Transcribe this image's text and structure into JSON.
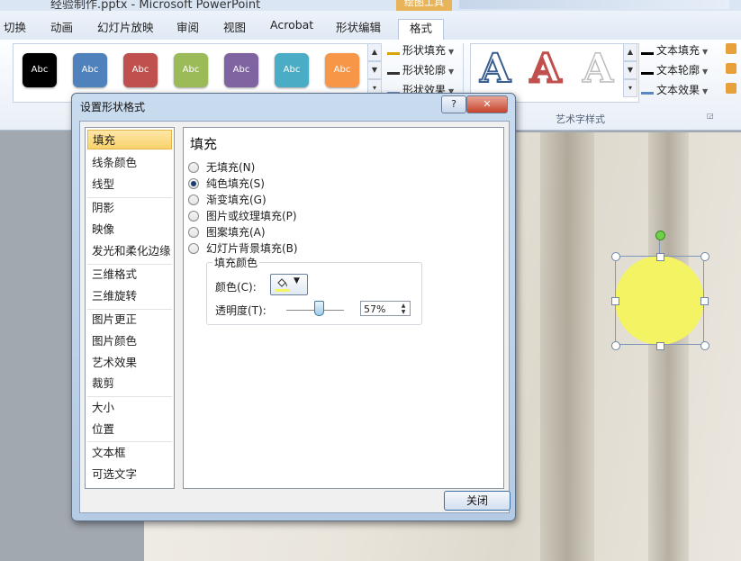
{
  "window": {
    "title": "经验制作.pptx - Microsoft PowerPoint",
    "context_tab_group": "绘图工具"
  },
  "ribbon": {
    "tabs": [
      {
        "label": "切换"
      },
      {
        "label": "动画"
      },
      {
        "label": "幻灯片放映"
      },
      {
        "label": "审阅"
      },
      {
        "label": "视图"
      },
      {
        "label": "Acrobat"
      },
      {
        "label": "形状编辑"
      },
      {
        "label": "格式",
        "active": true
      }
    ],
    "shape_styles": [
      {
        "label": "Abc",
        "color": "#000000"
      },
      {
        "label": "Abc",
        "color": "#4f81bd"
      },
      {
        "label": "Abc",
        "color": "#c0504d"
      },
      {
        "label": "Abc",
        "color": "#9bbb59"
      },
      {
        "label": "Abc",
        "color": "#8064a2"
      },
      {
        "label": "Abc",
        "color": "#4bacc6"
      },
      {
        "label": "Abc",
        "color": "#f79646"
      }
    ],
    "shape_commands": {
      "fill": "形状填充",
      "outline": "形状轮廓",
      "effects": "形状效果"
    },
    "text_commands": {
      "fill": "文本填充",
      "outline": "文本轮廓",
      "effects": "文本效果"
    },
    "wordart_group_label": "艺术字样式",
    "wordart_samples": [
      "A",
      "A",
      "A"
    ]
  },
  "dialog": {
    "title": "设置形状格式",
    "help_label": "?",
    "close_x": "✕",
    "nav_items": [
      {
        "label": "填充",
        "selected": true
      },
      {
        "label": "线条颜色"
      },
      {
        "label": "线型"
      },
      {
        "label": "阴影"
      },
      {
        "label": "映像"
      },
      {
        "label": "发光和柔化边缘"
      },
      {
        "label": "三维格式"
      },
      {
        "label": "三维旋转"
      },
      {
        "label": "图片更正"
      },
      {
        "label": "图片颜色"
      },
      {
        "label": "艺术效果"
      },
      {
        "label": "裁剪"
      },
      {
        "label": "大小"
      },
      {
        "label": "位置"
      },
      {
        "label": "文本框"
      },
      {
        "label": "可选文字"
      }
    ],
    "panel_title": "填充",
    "fill_options": [
      {
        "label": "无填充(N)",
        "checked": false
      },
      {
        "label": "纯色填充(S)",
        "checked": true
      },
      {
        "label": "渐变填充(G)",
        "checked": false
      },
      {
        "label": "图片或纹理填充(P)",
        "checked": false
      },
      {
        "label": "图案填充(A)",
        "checked": false
      },
      {
        "label": "幻灯片背景填充(B)",
        "checked": false
      }
    ],
    "fill_color_group": "填充颜色",
    "color_label": "颜色(C):",
    "color_value": "#f3f364",
    "transparency_label": "透明度(T):",
    "transparency_value": "57%",
    "transparency_fraction": 0.57,
    "close_button": "关闭"
  },
  "slide": {
    "shape_fill": "#f3f364"
  }
}
